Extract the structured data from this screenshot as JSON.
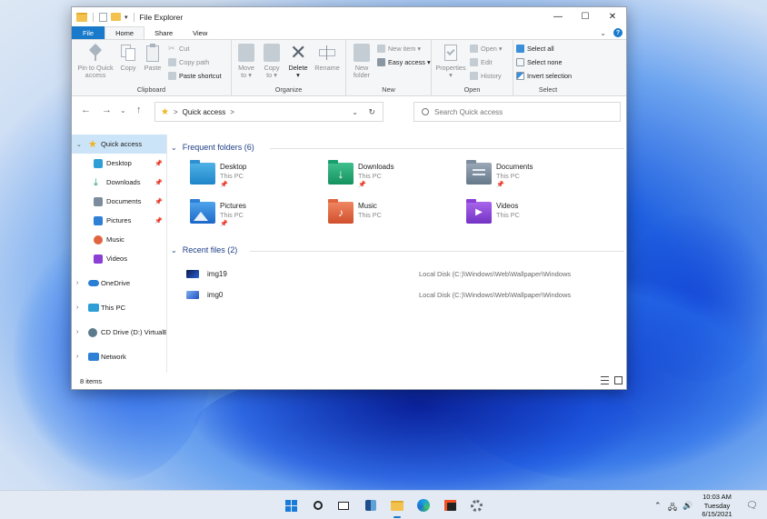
{
  "window": {
    "title": "File Explorer",
    "controls": {
      "minimize": "—",
      "maximize": "☐",
      "close": "✕"
    }
  },
  "tabs": [
    "File",
    "Home",
    "Share",
    "View"
  ],
  "ribbon": {
    "clipboard": {
      "label": "Clipboard",
      "pin_line1": "Pin to Quick",
      "pin_line2": "access",
      "copy": "Copy",
      "paste": "Paste",
      "cut": "Cut",
      "copy_path": "Copy path",
      "paste_shortcut": "Paste shortcut"
    },
    "organize": {
      "label": "Organize",
      "move_line1": "Move",
      "move_line2": "to ▾",
      "copy_line1": "Copy",
      "copy_line2": "to ▾",
      "delete_line1": "Delete",
      "delete_line2": "▾",
      "rename": "Rename"
    },
    "new": {
      "label": "New",
      "new_folder_line1": "New",
      "new_folder_line2": "folder",
      "new_item": "New item ▾",
      "easy_access": "Easy access ▾"
    },
    "open": {
      "label": "Open",
      "properties_line1": "Properties",
      "properties_line2": "▾",
      "open": "Open ▾",
      "edit": "Edit",
      "history": "History"
    },
    "select": {
      "label": "Select",
      "select_all": "Select all",
      "select_none": "Select none",
      "invert": "Invert selection"
    }
  },
  "address": {
    "path": "Quick access",
    "sep": ">"
  },
  "search": {
    "placeholder": "Search Quick access"
  },
  "nav": {
    "quick_access": "Quick access",
    "items": [
      {
        "label": "Desktop",
        "icon": "desktop-icon"
      },
      {
        "label": "Downloads",
        "icon": "download-icon"
      },
      {
        "label": "Documents",
        "icon": "documents-icon"
      },
      {
        "label": "Pictures",
        "icon": "pictures-icon"
      },
      {
        "label": "Music",
        "icon": "music-icon"
      },
      {
        "label": "Videos",
        "icon": "videos-icon"
      }
    ],
    "onedrive": "OneDrive",
    "this_pc": "This PC",
    "cd_drive": "CD Drive (D:) VirtualBox",
    "network": "Network"
  },
  "frequent": {
    "heading": "Frequent folders (6)",
    "folders": [
      {
        "name": "Desktop",
        "sub": "This PC",
        "pinned": true
      },
      {
        "name": "Downloads",
        "sub": "This PC",
        "pinned": true
      },
      {
        "name": "Documents",
        "sub": "This PC",
        "pinned": true
      },
      {
        "name": "Pictures",
        "sub": "This PC",
        "pinned": true
      },
      {
        "name": "Music",
        "sub": "This PC",
        "pinned": false
      },
      {
        "name": "Videos",
        "sub": "This PC",
        "pinned": false
      }
    ]
  },
  "recent": {
    "heading": "Recent files (2)",
    "files": [
      {
        "name": "img19",
        "location": "Local Disk (C:)\\Windows\\Web\\Wallpaper\\Windows"
      },
      {
        "name": "img0",
        "location": "Local Disk (C:)\\Windows\\Web\\Wallpaper\\Windows"
      }
    ]
  },
  "status": {
    "count": "8 items"
  },
  "clock": {
    "time": "10:03 AM",
    "day": "Tuesday",
    "date": "6/15/2021"
  },
  "colors": {
    "accent": "#1979ca",
    "folder_header": "#1e3f86",
    "selection": "#cce4f7"
  }
}
